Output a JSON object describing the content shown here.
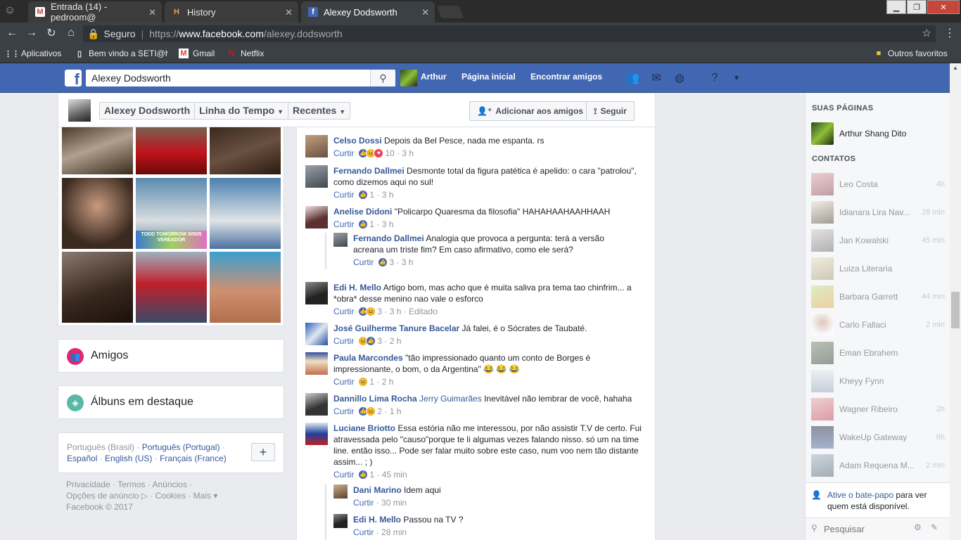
{
  "browser": {
    "tabs": [
      {
        "title": "Entrada (14) - pedroom@",
        "icon": "gmail-icon"
      },
      {
        "title": "History",
        "icon": "history-icon"
      },
      {
        "title": "Alexey Dodsworth",
        "icon": "facebook-icon"
      }
    ],
    "secure_label": "Seguro",
    "url_scheme": "https://",
    "url_host": "www.facebook.com",
    "url_path": "/alexey.dodsworth",
    "bookmarks": [
      {
        "label": "Aplicativos",
        "icon": "apps-grid-icon"
      },
      {
        "label": "Bem vindo a SETI@ho",
        "icon": "page-icon"
      },
      {
        "label": "Gmail",
        "icon": "gmail-icon"
      },
      {
        "label": "Netflix",
        "icon": "netflix-icon"
      }
    ],
    "other_bookmarks": "Outros favoritos"
  },
  "fb": {
    "search_value": "Alexey Dodsworth",
    "user_name": "Arthur",
    "nav_home": "Página inicial",
    "nav_find_friends": "Encontrar amigos"
  },
  "profile": {
    "name": "Alexey Dodsworth",
    "timeline": "Linha do Tempo",
    "recent": "Recentes",
    "add_friend": "Adicionar aos amigos",
    "follow": "Seguir",
    "photo_caption": "TODD TOMORROW 50505 VEREADOR"
  },
  "cards": {
    "friends": "Amigos",
    "albums": "Álbuns em destaque"
  },
  "langs": {
    "current": "Português (Brasil)",
    "options": [
      "Português (Portugal)",
      "Español",
      "English (US)",
      "Français (France)"
    ],
    "sep": " · "
  },
  "footer": {
    "line1": "Privacidade · Termos · Anúncios ·",
    "line2": "Opções de anúncio ▷ · Cookies · Mais ▾",
    "line3": "Facebook © 2017"
  },
  "comments": {
    "like": "Curtir",
    "c1": {
      "name": "Celso Dossi",
      "text": "Depois da Bel Pesce, nada me espanta. rs",
      "count": "10",
      "time": "3 h"
    },
    "c2": {
      "name": "Fernando Dallmei",
      "text": "Desmonte total da figura patética é apelido: o cara \"patrolou\", como dizemos aqui no sul!",
      "count": "1",
      "time": "3 h"
    },
    "c3": {
      "name": "Anelise Didoni",
      "text": "\"Policarpo Quaresma da filosofia\" HAHAHAAHAAHHAAH",
      "count": "1",
      "time": "3 h"
    },
    "c3r": {
      "name": "Fernando Dallmei",
      "text": "Analogia que provoca a pergunta: terá a versão acreana um triste fim? Em caso afirmativo, como ele será?",
      "count": "3",
      "time": "3 h"
    },
    "c4": {
      "name": "Edi H. Mello",
      "text": "Artigo bom, mas acho que é muita saliva pra tema tao chinfrim... a *obra* desse menino nao vale o esforco",
      "count": "3",
      "time": "3 h",
      "edited": "Editado"
    },
    "c5": {
      "name": "José Guilherme Tanure Bacelar",
      "text": "Já falei, é o Sócrates de Taubaté.",
      "count": "3",
      "time": "2 h"
    },
    "c6": {
      "name": "Paula Marcondes",
      "text": "\"tão impressionado quanto um conto de Borges é impressionante, o bom, o da Argentina\" 😂 😂 😂",
      "count": "1",
      "time": "2 h"
    },
    "c7": {
      "name": "Dannillo Lima Rocha",
      "tag": "Jerry Guimarães",
      "text": "Inevitável não lembrar de você, hahaha",
      "count": "2",
      "time": "1 h"
    },
    "c8": {
      "name": "Luciane Briotto",
      "text": "Essa estória não me interessou, por não assistir T.V de certo. Fui atravessada pelo \"causo\"porque te li algumas vezes falando nisso. só um na time line. então isso... Pode ser falar muito sobre este caso, num voo nem tão distante assim... ; )",
      "count": "1",
      "time": "45 min"
    },
    "c8r1": {
      "name": "Dani Marino",
      "text": "Idem aqui",
      "time": "30 min"
    },
    "c8r2": {
      "name": "Edi H. Mello",
      "text": "Passou na TV ?",
      "time": "28 min"
    }
  },
  "sidebar": {
    "pages_header": "SUAS PÁGINAS",
    "page_name": "Arthur Shang Dito",
    "contacts_header": "CONTATOS",
    "contacts": [
      {
        "name": "Leo Costa",
        "time": "4h"
      },
      {
        "name": "Idianara Lira Nav...",
        "time": "28 min"
      },
      {
        "name": "Jan Kowalski",
        "time": "45 min"
      },
      {
        "name": "Luiza Literaria",
        "time": ""
      },
      {
        "name": "Barbara Garrett",
        "time": "44 min"
      },
      {
        "name": "Carlo Fallaci",
        "time": "2 min"
      },
      {
        "name": "Eman Ebrahem",
        "time": ""
      },
      {
        "name": "Kheyy Fynn",
        "time": ""
      },
      {
        "name": "Wagner Ribeiro",
        "time": "2h"
      },
      {
        "name": "WakeUp Gateway",
        "time": "6h"
      },
      {
        "name": "Adam Requena M...",
        "time": "2 min"
      }
    ],
    "chat_activate": "Ative o bate-papo",
    "chat_rest": "para ver quem está disponível.",
    "chat_search": "Pesquisar"
  }
}
